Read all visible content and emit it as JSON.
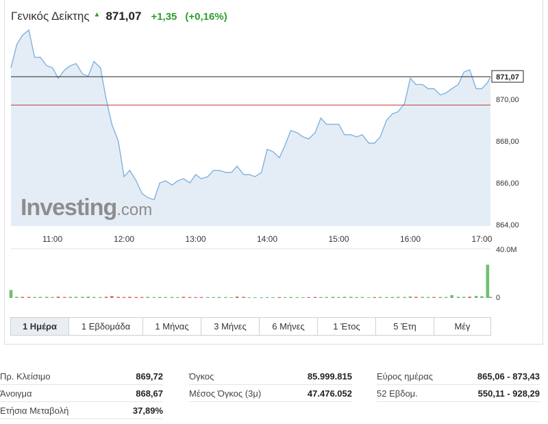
{
  "header": {
    "name": "Γενικός Δείκτης",
    "arrow": "▲",
    "last": "871,07",
    "change": "+1,35",
    "change_pct": "(+0,16%)",
    "accent_up": "#2f9e2f"
  },
  "watermark": {
    "bold": "Investing",
    "light": ".com"
  },
  "chart_data": {
    "type": "area",
    "x_unit": "hour",
    "x_ticks": [
      "11:00",
      "12:00",
      "13:00",
      "14:00",
      "15:00",
      "16:00",
      "17:00"
    ],
    "x_tick_values": [
      11,
      12,
      13,
      14,
      15,
      16,
      17
    ],
    "y_ticks": [
      "864,00",
      "866,00",
      "868,00",
      "870,00"
    ],
    "y_tick_values": [
      864,
      866,
      868,
      870
    ],
    "ylim": [
      863.94,
      873.1
    ],
    "xlim": [
      10.42,
      17.12
    ],
    "last_value_label": "871,07",
    "last_value": 871.07,
    "previous_close": 869.72,
    "grid": false,
    "colors": {
      "line": "#7fb1df",
      "fill": "#e4edf6",
      "last_line": "#222222",
      "prev_close_line": "#c0392b"
    },
    "series": [
      {
        "x": [
          10.42,
          10.5,
          10.58,
          10.67,
          10.75,
          10.83,
          10.92,
          11.0,
          11.08,
          11.17,
          11.25,
          11.33,
          11.42,
          11.5,
          11.58,
          11.67,
          11.75,
          11.83,
          11.92,
          12.0,
          12.08,
          12.17,
          12.25,
          12.33,
          12.42,
          12.5,
          12.58,
          12.67,
          12.75,
          12.83,
          12.92,
          13.0,
          13.08,
          13.17,
          13.25,
          13.33,
          13.42,
          13.5,
          13.58,
          13.67,
          13.75,
          13.83,
          13.92,
          14.0,
          14.08,
          14.17,
          14.25,
          14.33,
          14.42,
          14.5,
          14.58,
          14.67,
          14.75,
          14.83,
          14.92,
          15.0,
          15.08,
          15.17,
          15.25,
          15.33,
          15.42,
          15.5,
          15.58,
          15.67,
          15.75,
          15.83,
          15.92,
          16.0,
          16.08,
          16.17,
          16.25,
          16.33,
          16.42,
          16.5,
          16.58,
          16.67,
          16.75,
          16.83,
          16.92,
          17.0,
          17.08,
          17.12
        ],
        "y": [
          871.5,
          872.6,
          873.05,
          873.3,
          872.0,
          872.0,
          871.6,
          871.5,
          871.0,
          871.4,
          871.6,
          871.7,
          871.2,
          871.1,
          871.8,
          871.5,
          870.0,
          868.8,
          868.0,
          866.3,
          866.6,
          866.1,
          865.5,
          865.3,
          865.2,
          866.0,
          866.1,
          865.9,
          866.1,
          866.2,
          866.0,
          866.4,
          866.2,
          866.3,
          866.6,
          866.6,
          866.5,
          866.5,
          866.8,
          866.4,
          866.4,
          866.3,
          866.5,
          867.6,
          867.5,
          867.2,
          867.8,
          868.5,
          868.4,
          868.2,
          868.1,
          868.4,
          869.1,
          868.8,
          868.8,
          868.8,
          868.3,
          868.3,
          868.2,
          868.3,
          867.9,
          867.9,
          868.2,
          869.0,
          869.3,
          869.4,
          869.8,
          871.0,
          870.7,
          870.7,
          870.5,
          870.5,
          870.2,
          870.3,
          870.5,
          870.7,
          871.3,
          871.4,
          870.5,
          870.5,
          870.8,
          871.07
        ]
      }
    ],
    "volume": {
      "y_ticks": [
        "40.0M",
        "0"
      ],
      "y_tick_values": [
        40,
        0
      ],
      "ylim": [
        0,
        40
      ],
      "unit": "M",
      "colors": {
        "up": "#6fbf73",
        "down": "#e06666"
      },
      "x": [
        10.42,
        10.5,
        10.58,
        10.67,
        10.75,
        10.83,
        10.92,
        11.0,
        11.08,
        11.17,
        11.25,
        11.33,
        11.42,
        11.5,
        11.58,
        11.67,
        11.75,
        11.83,
        11.92,
        12.0,
        12.08,
        12.17,
        12.25,
        12.33,
        12.42,
        12.5,
        12.58,
        12.67,
        12.75,
        12.83,
        12.92,
        13.0,
        13.08,
        13.17,
        13.25,
        13.33,
        13.42,
        13.5,
        13.58,
        13.67,
        13.75,
        13.83,
        13.92,
        14.0,
        14.08,
        14.17,
        14.25,
        14.33,
        14.42,
        14.5,
        14.58,
        14.67,
        14.75,
        14.83,
        14.92,
        15.0,
        15.08,
        15.17,
        15.25,
        15.33,
        15.42,
        15.5,
        15.58,
        15.67,
        15.75,
        15.83,
        15.92,
        16.0,
        16.08,
        16.17,
        16.25,
        16.33,
        16.42,
        16.5,
        16.58,
        16.67,
        16.75,
        16.83,
        16.92,
        17.0,
        17.08,
        17.12
      ],
      "values": [
        8.0,
        1.2,
        1.1,
        1.1,
        1.0,
        1.1,
        1.2,
        0.9,
        1.3,
        1.0,
        1.1,
        1.2,
        1.1,
        1.4,
        1.0,
        0.9,
        1.2,
        1.9,
        1.1,
        1.0,
        1.2,
        1.0,
        1.0,
        1.1,
        0.9,
        1.0,
        1.0,
        1.0,
        0.8,
        1.2,
        0.9,
        0.8,
        0.9,
        0.9,
        0.8,
        1.0,
        0.9,
        0.7,
        1.4,
        1.1,
        0.6,
        0.6,
        0.6,
        0.8,
        0.7,
        0.9,
        0.8,
        1.0,
        0.8,
        0.7,
        0.8,
        1.0,
        0.9,
        1.0,
        1.2,
        0.9,
        1.2,
        1.1,
        0.9,
        1.0,
        0.7,
        0.9,
        1.0,
        0.9,
        1.0,
        1.1,
        1.0,
        1.5,
        1.2,
        1.1,
        1.0,
        1.0,
        1.0,
        1.0,
        2.9,
        1.2,
        1.1,
        1.3,
        2.0,
        1.7,
        33.5,
        1.2
      ],
      "direction": [
        "up",
        "up",
        "down",
        "down",
        "up",
        "up",
        "up",
        "up",
        "down",
        "down",
        "up",
        "up",
        "up",
        "up",
        "up",
        "up",
        "down",
        "down",
        "down",
        "down",
        "down",
        "down",
        "down",
        "up",
        "up",
        "up",
        "up",
        "up",
        "up",
        "down",
        "down",
        "down",
        "down",
        "up",
        "up",
        "up",
        "up",
        "up",
        "down",
        "down",
        "up",
        "up",
        "up",
        "up",
        "up",
        "down",
        "up",
        "up",
        "up",
        "up",
        "down",
        "down",
        "up",
        "up",
        "up",
        "up",
        "up",
        "up",
        "up",
        "up",
        "up",
        "down",
        "up",
        "up",
        "up",
        "up",
        "up",
        "up",
        "down",
        "up",
        "up",
        "down",
        "up",
        "up",
        "up",
        "up",
        "up",
        "down",
        "up",
        "up",
        "up",
        "up"
      ]
    }
  },
  "tabs": [
    {
      "label": "1 Ημέρα",
      "active": true
    },
    {
      "label": "1 Εβδομάδα",
      "active": false
    },
    {
      "label": "1 Μήνας",
      "active": false
    },
    {
      "label": "3 Μήνες",
      "active": false
    },
    {
      "label": "6 Μήνες",
      "active": false
    },
    {
      "label": "1 Έτος",
      "active": false
    },
    {
      "label": "5 Έτη",
      "active": false
    },
    {
      "label": "Μέγ",
      "active": false
    }
  ],
  "stats": {
    "col1": [
      {
        "label": "Πρ. Κλείσιμο",
        "value": "869,72"
      },
      {
        "label": "Άνοιγμα",
        "value": "868,67"
      },
      {
        "label": "Ετήσια Μεταβολή",
        "value": "37,89%"
      }
    ],
    "col2": [
      {
        "label": "Όγκος",
        "value": "85.999.815"
      },
      {
        "label": "Μέσος Όγκος (3μ)",
        "value": "47.476.052"
      }
    ],
    "col3": [
      {
        "label": "Εύρος ημέρας",
        "value": "865,06 - 873,43"
      },
      {
        "label": "52 Εβδομ.",
        "value": "550,11 - 928,29"
      }
    ]
  }
}
